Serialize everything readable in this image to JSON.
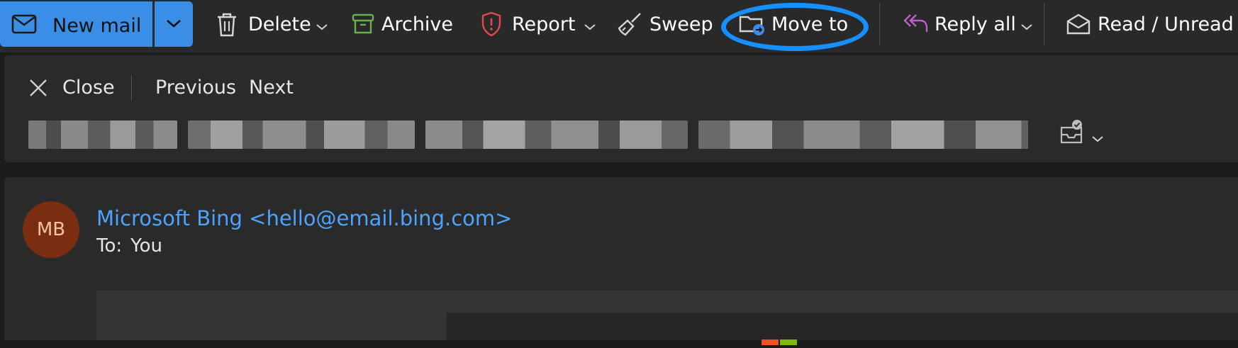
{
  "toolbar": {
    "new_mail": "New mail",
    "delete": "Delete",
    "archive": "Archive",
    "report": "Report",
    "sweep": "Sweep",
    "move_to": "Move to",
    "reply_all": "Reply all",
    "read_unread": "Read / Unread",
    "accent": "#3a8ee6",
    "highlight_color": "#1690ff"
  },
  "reading_nav": {
    "close": "Close",
    "previous": "Previous",
    "next": "Next"
  },
  "message": {
    "avatar_initials": "MB",
    "avatar_color": "#7a2d11",
    "sender": "Microsoft Bing <hello@email.bing.com>",
    "to_label": "To:",
    "to_value": "You"
  },
  "icons": {
    "new_mail": "mail-icon",
    "delete": "trash-icon",
    "archive": "archive-icon",
    "report": "shield-icon",
    "sweep": "broom-icon",
    "move_to": "folder-move-icon",
    "reply_all": "reply-all-icon",
    "read_unread": "envelope-open-icon",
    "close": "close-icon"
  }
}
